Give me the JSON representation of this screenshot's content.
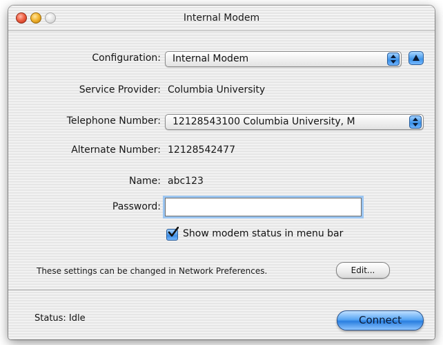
{
  "window": {
    "title": "Internal Modem"
  },
  "configuration": {
    "label": "Configuration:",
    "value": "Internal Modem"
  },
  "service_provider": {
    "label": "Service Provider:",
    "value": "Columbia University"
  },
  "telephone": {
    "label": "Telephone Number:",
    "value": "12128543100  Columbia University, M"
  },
  "alternate": {
    "label": "Alternate Number:",
    "value": "12128542477"
  },
  "name": {
    "label": "Name:",
    "value": "abc123"
  },
  "password": {
    "label": "Password:",
    "value": ""
  },
  "show_status": {
    "label": "Show modem status in menu bar",
    "checked": true
  },
  "note": {
    "text": "These settings can be changed in Network Preferences.",
    "edit_label": "Edit..."
  },
  "status": {
    "text": "Status: Idle"
  },
  "connect": {
    "label": "Connect"
  },
  "icons": [
    "close-icon",
    "minimize-icon",
    "zoom-icon",
    "popup-arrows-icon",
    "disclosure-triangle-icon",
    "checkmark-icon"
  ],
  "colors": {
    "accent": "#3f8fe6",
    "focus_ring": "#9cc6f2"
  }
}
